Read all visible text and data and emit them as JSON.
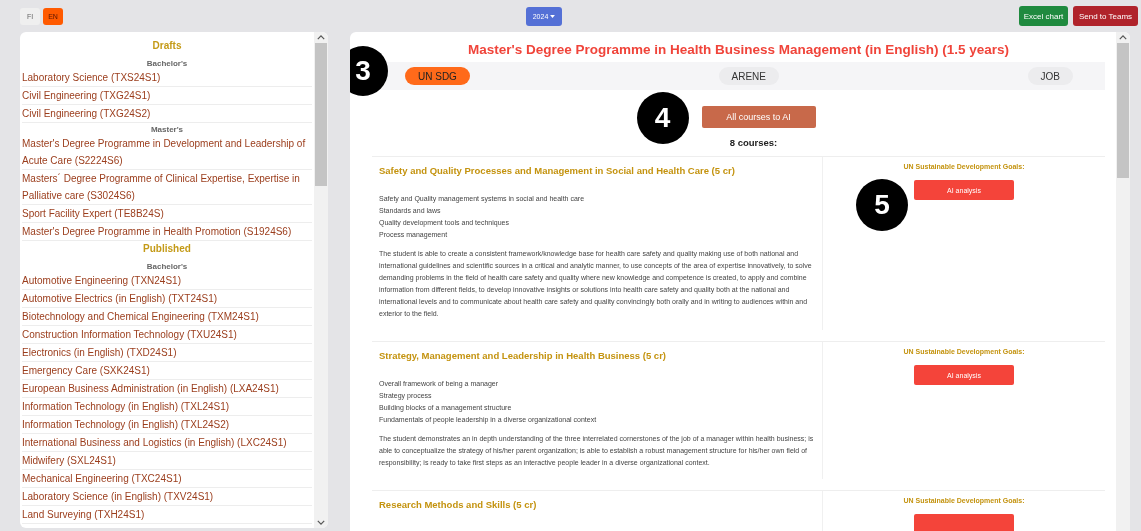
{
  "language_buttons": [
    {
      "label": "FI",
      "selected": false
    },
    {
      "label": "EN",
      "selected": true
    }
  ],
  "year_dropdown": {
    "label": "2024"
  },
  "actions": [
    {
      "label": "Excel chart",
      "kind": "excel"
    },
    {
      "label": "Send to Teams",
      "kind": "teams"
    }
  ],
  "sidebar": {
    "sections": [
      {
        "title": "Drafts",
        "groups": [
          {
            "title": "Bachelor's",
            "items": [
              "Laboratory Science (TXS24S1)",
              "Civil Engineering (TXG24S1)",
              "Civil Engineering (TXG24S2)"
            ]
          },
          {
            "title": "Master's",
            "items": [
              "Master's Degree Programme in Development and Leadership of Acute Care (S2224S6)",
              "Masters´ Degree Programme of Clinical Expertise, Expertise in Palliative care (S3024S6)",
              "Sport Facility Expert (TE8B24S)",
              "Master's Degree Programme in Health Promotion (S1924S6)"
            ]
          }
        ]
      },
      {
        "title": "Published",
        "groups": [
          {
            "title": "Bachelor's",
            "items": [
              "Automotive Engineering (TXN24S1)",
              "Automotive Electrics (in English) (TXT24S1)",
              "Biotechnology and Chemical Engineering (TXM24S1)",
              "Construction Information Technology (TXU24S1)",
              "Electronics (in English) (TXD24S1)",
              "Emergency Care (SXK24S1)",
              "European Business Administration (in English) (LXA24S1)",
              "Information Technology (in English) (TXL24S1)",
              "Information Technology (in English) (TXL24S2)",
              "International Business and Logistics (in English) (LXC24S1)",
              "Midwifery (SXL24S1)",
              "Mechanical Engineering (TXC24S1)",
              "Laboratory Science (in English) (TXV24S1)",
              "Land Surveying (TXH24S1)"
            ]
          }
        ]
      }
    ]
  },
  "programme": {
    "title": "Master's Degree Programme in Health Business Management (in English) (1.5 years)",
    "tabs_callout": "3",
    "tabs": [
      {
        "label": "UN SDG",
        "selected": true
      },
      {
        "label": "ARENE",
        "selected": false
      },
      {
        "label": "JOB",
        "selected": false
      }
    ],
    "all_courses_button": {
      "label": "All courses to AI",
      "callout": "4"
    },
    "course_count": "8 courses:",
    "courses": [
      {
        "title": "Safety and Quality Processes and Management in Social and Health Care (5 cr)",
        "topics": [
          "Safety and Quality management systems in social and health care",
          "Standards and laws",
          "Quality development tools and techniques",
          "Process management"
        ],
        "description": "The student is able to create a consistent framework/knowledge base for health care safety and quality making use of both national and international guidelines and scientific sources in a critical and analytic manner, to use concepts of the area of expertise innovatively, to solve demanding problems in the field of health care safety and quality where new knowledge and competence is created, to apply and combine information from different fields, to develop innovative insights or solutions into health care safety and quality both at the national and international levels and to communicate about health care safety and quality convincingly both orally and in writing to audiences within and exterior to the field.",
        "sdg_heading": "UN Sustainable Development Goals:",
        "button": "AI analysis",
        "callout": "5"
      },
      {
        "title": "Strategy, Management and Leadership in Health Business (5 cr)",
        "topics": [
          "Overall framework of being a manager",
          "Strategy process",
          "Building blocks of a management structure",
          "Fundamentals of people leadership in a diverse organizational context"
        ],
        "description": "The student demonstrates an in depth understanding of the three interrelated cornerstones of the job of a manager within health business; is able to conceptualize the strategy of his/her parent organization; is able to establish a robust management structure for his/her own field of responsibility; is ready to take first steps as an interactive people leader in a diverse organizational context.",
        "sdg_heading": "UN Sustainable Development Goals:",
        "button": "AI analysis"
      },
      {
        "title": "Research Methods and Skills (5 cr)",
        "sdg_heading": "UN Sustainable Development Goals:",
        "button_partial": true
      }
    ]
  }
}
